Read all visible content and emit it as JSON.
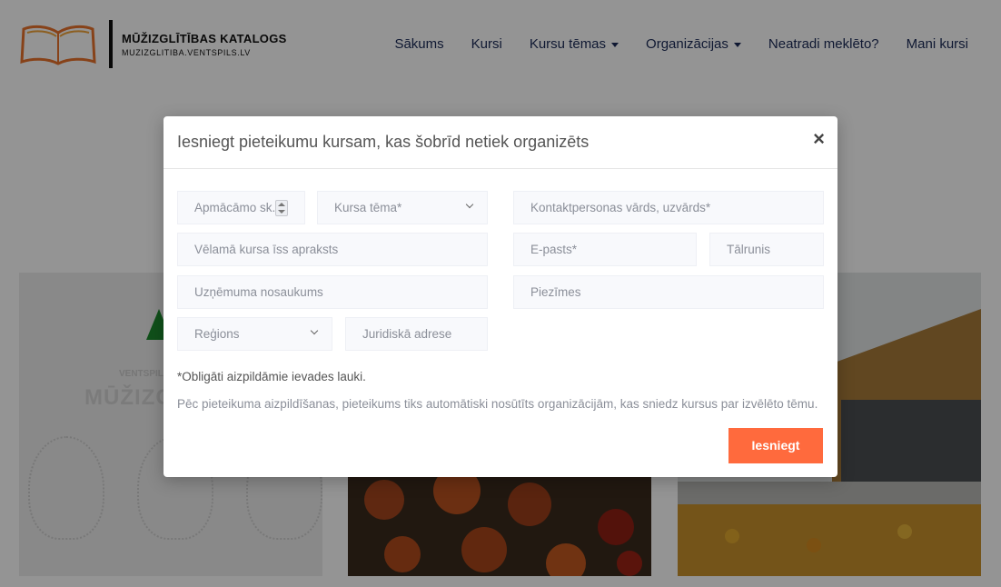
{
  "header": {
    "logo_title": "MŪŽIZGLĪTĪBAS KATALOGS",
    "logo_subtitle": "MUZIZGLITIBA.VENTSPILS.LV",
    "nav": [
      {
        "label": "Sākums"
      },
      {
        "label": "Kursi"
      },
      {
        "label": "Kursu tēmas",
        "dropdown": true
      },
      {
        "label": "Organizācijas",
        "dropdown": true
      },
      {
        "label": "Neatradi meklēto?"
      },
      {
        "label": "Mani kursi"
      }
    ]
  },
  "background": {
    "card1_small": "VENTSPILS",
    "card1_title": "MŪŽIZGLĪT"
  },
  "modal": {
    "title": "Iesniegt pieteikumu kursam, kas šobrīd netiek organizēts",
    "close_symbol": "×",
    "fields": {
      "students": "Apmācāmo sk.",
      "topic": "Kursa tēma*",
      "contact_name": "Kontaktpersonas vārds, uzvārds*",
      "description": "Vēlamā kursa īss apraksts",
      "email": "E-pasts*",
      "phone": "Tālrunis",
      "company": "Uzņēmuma nosaukums",
      "notes": "Piezīmes",
      "region": "Reģions",
      "legal_address": "Juridiskā adrese"
    },
    "required_note": "*Obligāti aizpildāmie ievades lauki.",
    "info_note": "Pēc pieteikuma aizpildīšanas, pieteikums tiks automātiski nosūtīts organizācijām, kas sniedz kursus par izvēlēto tēmu.",
    "submit_label": "Iesniegt"
  },
  "colors": {
    "nav_text": "#1a2a56",
    "accent": "#ff6a3d",
    "overlay": "rgba(0,0,0,0.42)"
  }
}
